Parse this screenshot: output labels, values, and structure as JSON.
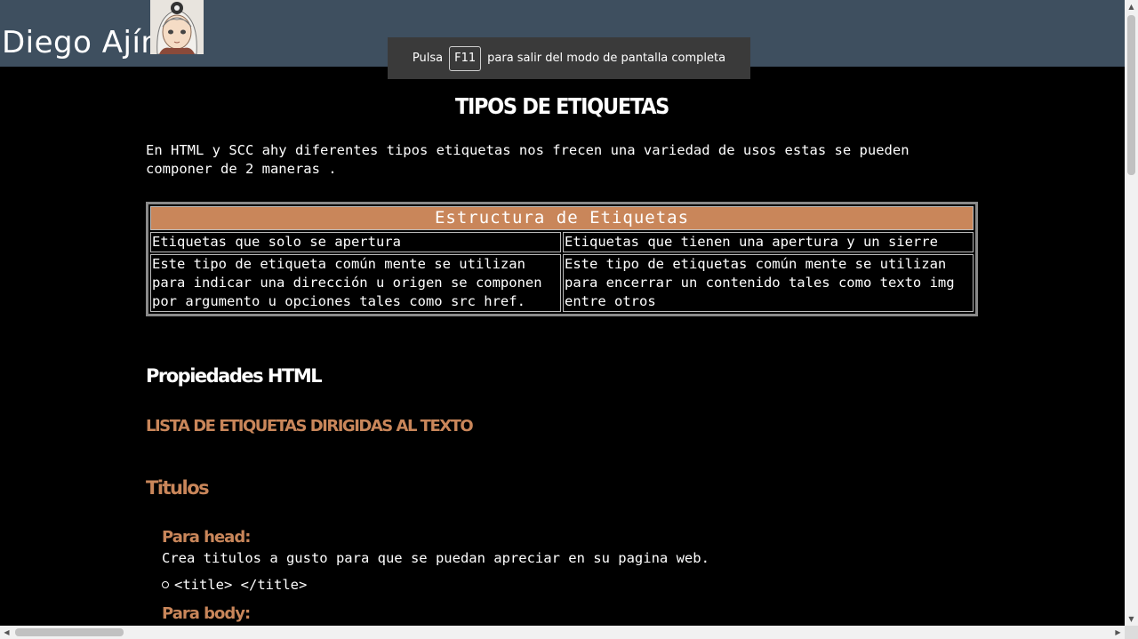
{
  "header": {
    "brand": "Diego Ajín",
    "avatar_icon": "anime-avatar-icon"
  },
  "toast": {
    "prefix": "Pulsa",
    "key": "F11",
    "suffix": "para salir del modo de pantalla completa"
  },
  "main": {
    "title": "TIPOS DE ETIQUETAS",
    "intro": "En HTML y SCC ahy diferentes tipos etiquetas nos frecen una variedad de usos estas se pueden componer de 2 maneras .",
    "table": {
      "caption": "Estructura de Etiquetas",
      "rows": [
        [
          "Etiquetas que solo se apertura",
          "Etiquetas que tienen una apertura y un sierre"
        ],
        [
          "Este tipo de etiqueta común mente se utilizan para indicar una dirección u origen se componen por argumento u opciones tales como src href.",
          "Este tipo de etiquetas común mente se utilizan para encerrar un contenido tales como texto img entre otros"
        ]
      ]
    },
    "props_heading": "Propiedades HTML",
    "list_heading": "LISTA DE ETIQUETAS DIRIGIDAS AL TEXTO",
    "titulos_heading": "Titulos",
    "para_head": "Para head:",
    "para_head_desc": "Crea titulos a gusto para que se puedan apreciar en su pagina web.",
    "para_head_tag": "<title> </title>",
    "para_body": "Para body:"
  },
  "colors": {
    "header_bg": "#3e4f5f",
    "accent": "#c9865a",
    "page_bg": "#000000"
  }
}
